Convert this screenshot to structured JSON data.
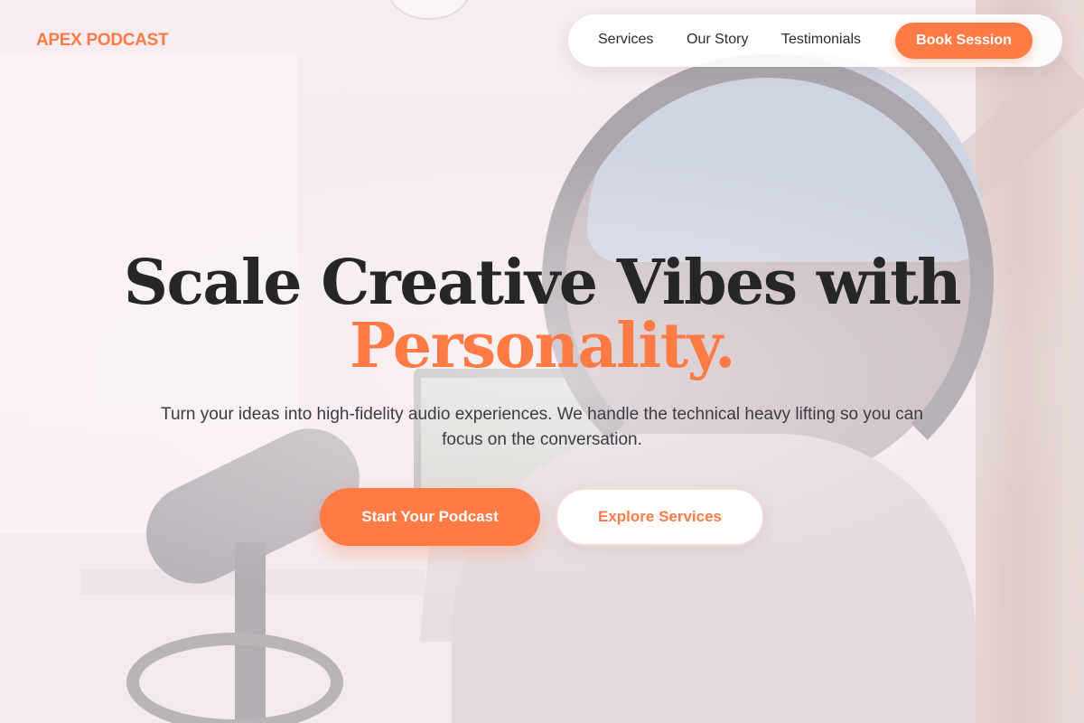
{
  "brand": {
    "logo_text": "APEX PODCAST",
    "accent_color": "#ff7b45"
  },
  "nav": {
    "links": [
      {
        "label": "Services"
      },
      {
        "label": "Our Story"
      },
      {
        "label": "Testimonials"
      }
    ],
    "cta_label": "Book Session"
  },
  "hero": {
    "title_line1": "Scale Creative Vibes with",
    "title_line2": "Personality.",
    "subtitle": "Turn your ideas into high-fidelity audio experiences. We handle the technical heavy lifting so you can focus on the conversation.",
    "primary_button": "Start Your Podcast",
    "secondary_button": "Explore Services"
  },
  "background": {
    "description_icon": "podcast-studio-photo"
  }
}
